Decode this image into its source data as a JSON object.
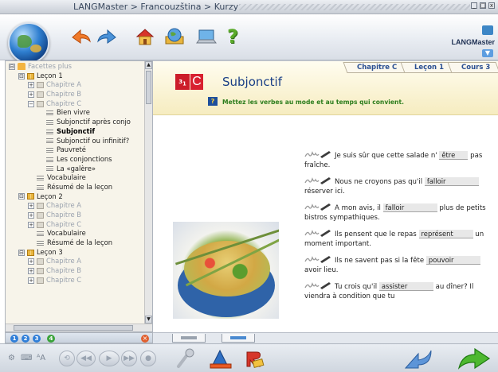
{
  "window": {
    "title": "LANGMaster > Francouzština > Kurzy"
  },
  "toolbar": {
    "logo_text": "LANGMaster",
    "buttons": [
      "back-icon",
      "forward-icon",
      "home-icon",
      "globe-book-icon",
      "laptop-icon",
      "help-icon"
    ],
    "help_label": "?"
  },
  "sidebar": {
    "tree": [
      {
        "label": "Facettes plus",
        "depth": 0,
        "type": "root",
        "toggle": "⊟",
        "style": "dim"
      },
      {
        "label": "Leçon 1",
        "depth": 1,
        "type": "book",
        "toggle": "⊟",
        "style": "normal"
      },
      {
        "label": "Chapitre A",
        "depth": 2,
        "type": "book",
        "toggle": "+",
        "style": "dim"
      },
      {
        "label": "Chapitre B",
        "depth": 2,
        "type": "book",
        "toggle": "+",
        "style": "dim"
      },
      {
        "label": "Chapitre C",
        "depth": 2,
        "type": "book",
        "toggle": "−",
        "style": "dim"
      },
      {
        "label": "Bien vivre",
        "depth": 3,
        "type": "page",
        "toggle": "",
        "style": "normal"
      },
      {
        "label": "Subjonctif après conjo",
        "depth": 3,
        "type": "page",
        "toggle": "",
        "style": "normal"
      },
      {
        "label": "Subjonctif",
        "depth": 3,
        "type": "page",
        "toggle": "",
        "style": "bold"
      },
      {
        "label": "Subjonctif ou infinitif?",
        "depth": 3,
        "type": "page",
        "toggle": "",
        "style": "normal"
      },
      {
        "label": "Pauvreté",
        "depth": 3,
        "type": "page",
        "toggle": "",
        "style": "normal"
      },
      {
        "label": "Les conjonctions",
        "depth": 3,
        "type": "page",
        "toggle": "",
        "style": "normal"
      },
      {
        "label": "La «galère»",
        "depth": 3,
        "type": "page",
        "toggle": "",
        "style": "normal"
      },
      {
        "label": "Vocabulaire",
        "depth": 2,
        "type": "page",
        "toggle": "",
        "style": "normal"
      },
      {
        "label": "Résumé de la leçon",
        "depth": 2,
        "type": "page",
        "toggle": "",
        "style": "normal"
      },
      {
        "label": "Leçon 2",
        "depth": 1,
        "type": "book",
        "toggle": "⊟",
        "style": "normal"
      },
      {
        "label": "Chapitre A",
        "depth": 2,
        "type": "book",
        "toggle": "+",
        "style": "dim"
      },
      {
        "label": "Chapitre B",
        "depth": 2,
        "type": "book",
        "toggle": "+",
        "style": "dim"
      },
      {
        "label": "Chapitre C",
        "depth": 2,
        "type": "book",
        "toggle": "+",
        "style": "dim"
      },
      {
        "label": "Vocabulaire",
        "depth": 2,
        "type": "page",
        "toggle": "",
        "style": "normal"
      },
      {
        "label": "Résumé de la leçon",
        "depth": 2,
        "type": "page",
        "toggle": "",
        "style": "normal"
      },
      {
        "label": "Leçon 3",
        "depth": 1,
        "type": "book",
        "toggle": "⊟",
        "style": "normal"
      },
      {
        "label": "Chapitre A",
        "depth": 2,
        "type": "book",
        "toggle": "+",
        "style": "dim"
      },
      {
        "label": "Chapitre B",
        "depth": 2,
        "type": "book",
        "toggle": "+",
        "style": "dim"
      },
      {
        "label": "Chapitre C",
        "depth": 2,
        "type": "book",
        "toggle": "+",
        "style": "dim"
      }
    ],
    "footer_buttons": [
      "1",
      "2",
      "3",
      "4"
    ],
    "close_label": "×"
  },
  "content": {
    "breadcrumbs": [
      "Chapitre C",
      "Leçon 1",
      "Cours 3"
    ],
    "badge_number": "3",
    "badge_sub": "1",
    "badge_letter": "C",
    "title": "Subjonctif",
    "help_label": "?",
    "instruction": "Mettez les verbes au mode et au temps qui convient.",
    "exercises": [
      {
        "before": "Je suis sûr que cette salade n'",
        "blank": "être",
        "after": "pas fraîche."
      },
      {
        "before": "Nous ne croyons pas qu'il",
        "blank": "falloir",
        "after": "réserver ici."
      },
      {
        "before": "A mon avis, il",
        "blank": "falloir",
        "after": "plus de petits bistros sympathiques."
      },
      {
        "before": "Ils pensent que le repas",
        "blank": "représent",
        "after": "un moment important."
      },
      {
        "before": "Ils ne savent pas si la fête",
        "blank": "pouvoir",
        "after": "avoir lieu."
      },
      {
        "before": "Tu crois qu'il",
        "blank": "assister",
        "after": "au dîner? Il viendra à condition que tu"
      }
    ]
  },
  "player": {
    "small_icons": [
      "settings-icon",
      "keyboard-icon",
      "font-size-icon"
    ],
    "font_size_label": "ᴬA",
    "media_buttons": [
      "replay-icon",
      "rewind-icon",
      "play-icon",
      "forward-icon",
      "record-icon"
    ],
    "colors": {
      "accent_red": "#cc1d2a",
      "title_blue": "#1a3f86",
      "instruction_green": "#2d7d1c"
    }
  }
}
